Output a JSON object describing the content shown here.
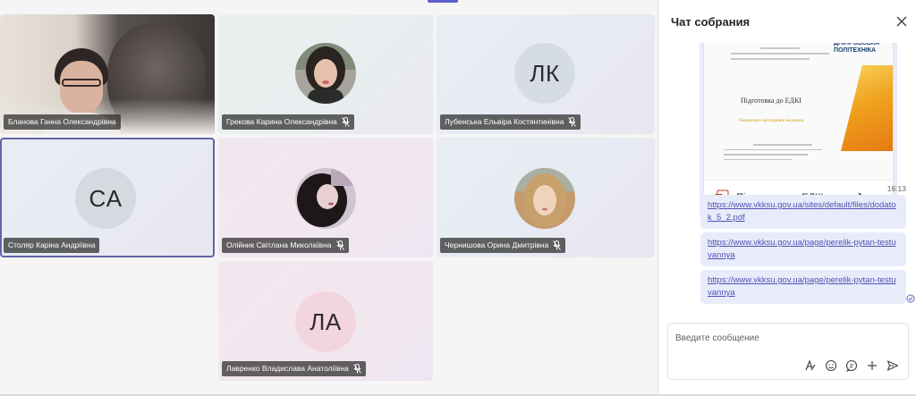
{
  "participants": [
    {
      "name": "Бланова Ганна Олександрівна",
      "type": "video",
      "muted": false
    },
    {
      "name": "Грекова Карина Олександрівна",
      "type": "photo",
      "muted": true
    },
    {
      "name": "Лубенська Ельвіра Костянтинівна",
      "type": "initials",
      "initials": "ЛК",
      "muted": true
    },
    {
      "name": "Столяр Каріна Андріївна",
      "type": "initials",
      "initials": "CA",
      "muted": false,
      "selected": true
    },
    {
      "name": "Олійник Світлана Миколаївна",
      "type": "photo",
      "muted": true
    },
    {
      "name": "Чернишова Орина Дмитрівна",
      "type": "photo",
      "muted": true
    },
    {
      "name": "Лавренко Владислава Анатоліївна",
      "type": "initials",
      "initials": "ЛА",
      "muted": true
    }
  ],
  "chat": {
    "title": "Чат собрания",
    "file": {
      "name": "Підготовка до ЕДКІ з ЦП...",
      "preview_title": "Підготовка до ЕДКІ",
      "preview_subtitle": "Навчально-методичне видання",
      "preview_logo": "ДНІПРОВСЬКА ПОЛІТЕХНІКА"
    },
    "time": "16:13",
    "messages": [
      "https://www.vkksu.gov.ua/sites/default/files/dodatok_5_2.pdf",
      "https://www.vkksu.gov.ua/page/perelik-pytan-testuvannya",
      "https://www.vkksu.gov.ua/page/perelik-pytan-testuvannya"
    ],
    "compose_placeholder": "Введите сообщение"
  },
  "colors": {
    "accent": "#5b5fc7",
    "bubble": "#e8ebfa",
    "link": "#4f52b2"
  }
}
